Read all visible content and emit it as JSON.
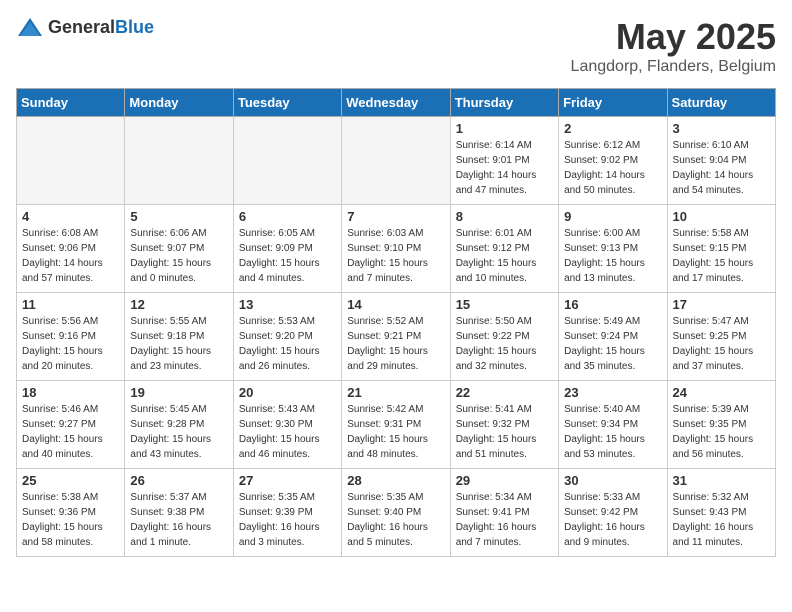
{
  "header": {
    "logo_general": "General",
    "logo_blue": "Blue",
    "month_year": "May 2025",
    "location": "Langdorp, Flanders, Belgium"
  },
  "days_of_week": [
    "Sunday",
    "Monday",
    "Tuesday",
    "Wednesday",
    "Thursday",
    "Friday",
    "Saturday"
  ],
  "weeks": [
    [
      {
        "day": "",
        "info": ""
      },
      {
        "day": "",
        "info": ""
      },
      {
        "day": "",
        "info": ""
      },
      {
        "day": "",
        "info": ""
      },
      {
        "day": "1",
        "info": "Sunrise: 6:14 AM\nSunset: 9:01 PM\nDaylight: 14 hours\nand 47 minutes."
      },
      {
        "day": "2",
        "info": "Sunrise: 6:12 AM\nSunset: 9:02 PM\nDaylight: 14 hours\nand 50 minutes."
      },
      {
        "day": "3",
        "info": "Sunrise: 6:10 AM\nSunset: 9:04 PM\nDaylight: 14 hours\nand 54 minutes."
      }
    ],
    [
      {
        "day": "4",
        "info": "Sunrise: 6:08 AM\nSunset: 9:06 PM\nDaylight: 14 hours\nand 57 minutes."
      },
      {
        "day": "5",
        "info": "Sunrise: 6:06 AM\nSunset: 9:07 PM\nDaylight: 15 hours\nand 0 minutes."
      },
      {
        "day": "6",
        "info": "Sunrise: 6:05 AM\nSunset: 9:09 PM\nDaylight: 15 hours\nand 4 minutes."
      },
      {
        "day": "7",
        "info": "Sunrise: 6:03 AM\nSunset: 9:10 PM\nDaylight: 15 hours\nand 7 minutes."
      },
      {
        "day": "8",
        "info": "Sunrise: 6:01 AM\nSunset: 9:12 PM\nDaylight: 15 hours\nand 10 minutes."
      },
      {
        "day": "9",
        "info": "Sunrise: 6:00 AM\nSunset: 9:13 PM\nDaylight: 15 hours\nand 13 minutes."
      },
      {
        "day": "10",
        "info": "Sunrise: 5:58 AM\nSunset: 9:15 PM\nDaylight: 15 hours\nand 17 minutes."
      }
    ],
    [
      {
        "day": "11",
        "info": "Sunrise: 5:56 AM\nSunset: 9:16 PM\nDaylight: 15 hours\nand 20 minutes."
      },
      {
        "day": "12",
        "info": "Sunrise: 5:55 AM\nSunset: 9:18 PM\nDaylight: 15 hours\nand 23 minutes."
      },
      {
        "day": "13",
        "info": "Sunrise: 5:53 AM\nSunset: 9:20 PM\nDaylight: 15 hours\nand 26 minutes."
      },
      {
        "day": "14",
        "info": "Sunrise: 5:52 AM\nSunset: 9:21 PM\nDaylight: 15 hours\nand 29 minutes."
      },
      {
        "day": "15",
        "info": "Sunrise: 5:50 AM\nSunset: 9:22 PM\nDaylight: 15 hours\nand 32 minutes."
      },
      {
        "day": "16",
        "info": "Sunrise: 5:49 AM\nSunset: 9:24 PM\nDaylight: 15 hours\nand 35 minutes."
      },
      {
        "day": "17",
        "info": "Sunrise: 5:47 AM\nSunset: 9:25 PM\nDaylight: 15 hours\nand 37 minutes."
      }
    ],
    [
      {
        "day": "18",
        "info": "Sunrise: 5:46 AM\nSunset: 9:27 PM\nDaylight: 15 hours\nand 40 minutes."
      },
      {
        "day": "19",
        "info": "Sunrise: 5:45 AM\nSunset: 9:28 PM\nDaylight: 15 hours\nand 43 minutes."
      },
      {
        "day": "20",
        "info": "Sunrise: 5:43 AM\nSunset: 9:30 PM\nDaylight: 15 hours\nand 46 minutes."
      },
      {
        "day": "21",
        "info": "Sunrise: 5:42 AM\nSunset: 9:31 PM\nDaylight: 15 hours\nand 48 minutes."
      },
      {
        "day": "22",
        "info": "Sunrise: 5:41 AM\nSunset: 9:32 PM\nDaylight: 15 hours\nand 51 minutes."
      },
      {
        "day": "23",
        "info": "Sunrise: 5:40 AM\nSunset: 9:34 PM\nDaylight: 15 hours\nand 53 minutes."
      },
      {
        "day": "24",
        "info": "Sunrise: 5:39 AM\nSunset: 9:35 PM\nDaylight: 15 hours\nand 56 minutes."
      }
    ],
    [
      {
        "day": "25",
        "info": "Sunrise: 5:38 AM\nSunset: 9:36 PM\nDaylight: 15 hours\nand 58 minutes."
      },
      {
        "day": "26",
        "info": "Sunrise: 5:37 AM\nSunset: 9:38 PM\nDaylight: 16 hours\nand 1 minute."
      },
      {
        "day": "27",
        "info": "Sunrise: 5:35 AM\nSunset: 9:39 PM\nDaylight: 16 hours\nand 3 minutes."
      },
      {
        "day": "28",
        "info": "Sunrise: 5:35 AM\nSunset: 9:40 PM\nDaylight: 16 hours\nand 5 minutes."
      },
      {
        "day": "29",
        "info": "Sunrise: 5:34 AM\nSunset: 9:41 PM\nDaylight: 16 hours\nand 7 minutes."
      },
      {
        "day": "30",
        "info": "Sunrise: 5:33 AM\nSunset: 9:42 PM\nDaylight: 16 hours\nand 9 minutes."
      },
      {
        "day": "31",
        "info": "Sunrise: 5:32 AM\nSunset: 9:43 PM\nDaylight: 16 hours\nand 11 minutes."
      }
    ]
  ]
}
